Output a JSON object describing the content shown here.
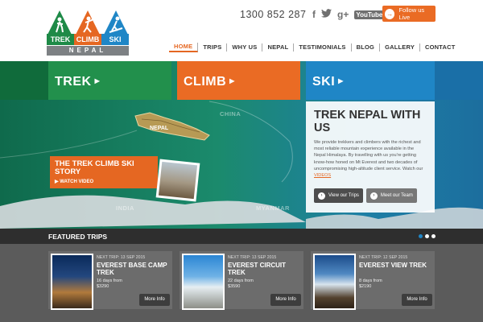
{
  "brand": {
    "name_parts": [
      "TREK",
      "CLIMB",
      "SKI"
    ],
    "country": "NEPAL",
    "colors": {
      "green": "#22904c",
      "orange": "#ea6b24",
      "blue": "#1f86c6"
    }
  },
  "header": {
    "phone": "1300 852 287",
    "social": [
      "f",
      "twitter",
      "g+",
      "YouTube"
    ],
    "follow_label": "Follow us Live"
  },
  "nav": {
    "items": [
      "HOME",
      "TRIPS",
      "WHY US",
      "NEPAL",
      "TESTIMONIALS",
      "BLOG",
      "GALLERY",
      "CONTACT"
    ],
    "active": "HOME"
  },
  "hero": {
    "tabs": [
      "TREK",
      "CLIMB",
      "SKI"
    ],
    "map_labels": {
      "china": "CHINA",
      "nepal": "NEPAL",
      "india": "INDIA",
      "myanmar": "MYANMAR"
    },
    "story": {
      "title": "THE TREK CLIMB SKI STORY",
      "video_label": "WATCH VIDEO"
    },
    "panel": {
      "heading": "TREK NEPAL WITH US",
      "body": "We provide trekkers and climbers with the richest and most reliable mountain experience available in the Nepal Himalaya. By travelling with us you're getting know-how honed on Mt Everest and two decades of uncompromising high-altitude client service. Watch our",
      "videos_link": "VIDEOS",
      "btn_trips": "View our Trips",
      "btn_team": "Meet our Team"
    }
  },
  "featured": {
    "title": "FEATURED TRIPS",
    "cards": [
      {
        "next": "NEXT TRIP: 13 SEP 2015",
        "name": "EVEREST BASE CAMP TREK",
        "days": "16 days from",
        "price": "$3290",
        "more": "More Info"
      },
      {
        "next": "NEXT TRIP: 13 SEP 2015",
        "name": "EVEREST CIRCUIT TREK",
        "days": "22 days from",
        "price": "$3590",
        "more": "More Info"
      },
      {
        "next": "NEXT TRIP: 12 SEP 2015",
        "name": "EVEREST VIEW TREK",
        "days": "8 days from",
        "price": "$2190",
        "more": "More Info"
      }
    ]
  }
}
